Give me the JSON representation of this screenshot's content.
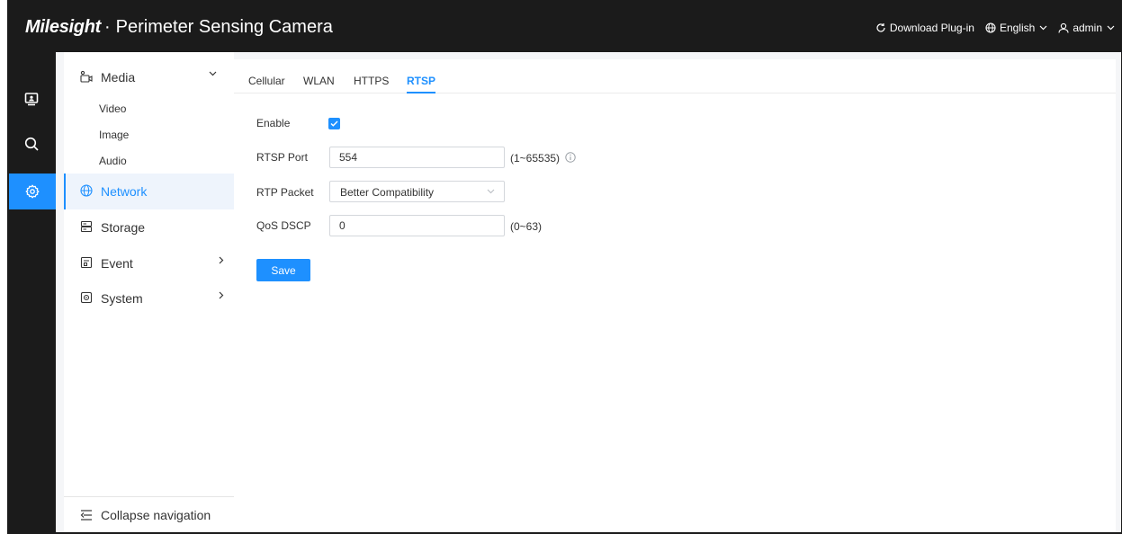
{
  "header": {
    "brand_logo": "Milesight",
    "brand_separator": "·",
    "product_title": "Perimeter Sensing Camera",
    "download_plugin": "Download Plug-in",
    "language": "English",
    "user": "admin"
  },
  "rail": {
    "items": [
      "live-view",
      "search",
      "settings"
    ],
    "active": "settings"
  },
  "sidebar": {
    "groups": [
      {
        "label": "Media",
        "subitems": [
          "Video",
          "Image",
          "Audio"
        ],
        "expanded": true
      },
      {
        "label": "Network",
        "active": true
      },
      {
        "label": "Storage"
      },
      {
        "label": "Event",
        "has_children": true
      },
      {
        "label": "System",
        "has_children": true
      }
    ],
    "collapse_label": "Collapse navigation"
  },
  "tabs": [
    {
      "label": "Cellular"
    },
    {
      "label": "WLAN"
    },
    {
      "label": "HTTPS"
    },
    {
      "label": "RTSP",
      "active": true
    }
  ],
  "form": {
    "enable_label": "Enable",
    "enable_checked": true,
    "rtsp_port_label": "RTSP Port",
    "rtsp_port_value": "554",
    "rtsp_port_hint": "(1~65535)",
    "rtp_packet_label": "RTP Packet",
    "rtp_packet_value": "Better Compatibility",
    "qos_dscp_label": "QoS DSCP",
    "qos_dscp_value": "0",
    "qos_dscp_hint": "(0~63)",
    "save_label": "Save"
  },
  "colors": {
    "accent": "#1e90ff",
    "header_bg": "#1b1b1b",
    "content_bg": "#f5f6f8"
  }
}
